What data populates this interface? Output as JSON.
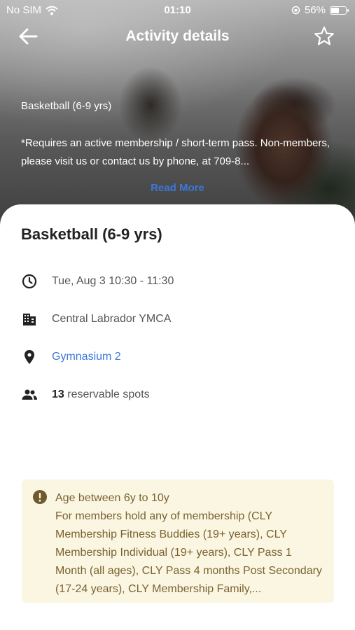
{
  "status": {
    "carrier": "No SIM",
    "time": "01:10",
    "battery": "56%",
    "battery_level": 0.56
  },
  "nav": {
    "title": "Activity details",
    "back_icon": "arrow-left-icon",
    "favorite_icon": "star-outline-icon"
  },
  "hero": {
    "activity_name": "Basketball (6-9 yrs)",
    "description": "*Requires an active membership / short-term pass. Non-members, please visit us or contact us by phone, at 709-8...",
    "read_more": "Read More"
  },
  "details": {
    "title": "Basketball (6-9 yrs)",
    "datetime": "Tue, Aug 3 10:30 - 11:30",
    "location": "Central Labrador YMCA",
    "room": "Gymnasium 2",
    "spots_count": "13",
    "spots_label": " reservable spots"
  },
  "notice": {
    "line1": "Age between 6y to 10y",
    "text": "For members hold any of membership (CLY Membership Fitness Buddies (19+ years), CLY Membership Individual (19+ years), CLY Pass 1 Month (all ages), CLY Pass 4 months Post Secondary (17-24 years), CLY Membership Family,..."
  },
  "colors": {
    "link": "#3b78d8",
    "notice_bg": "#fbf6e2",
    "notice_text": "#7a6230"
  }
}
